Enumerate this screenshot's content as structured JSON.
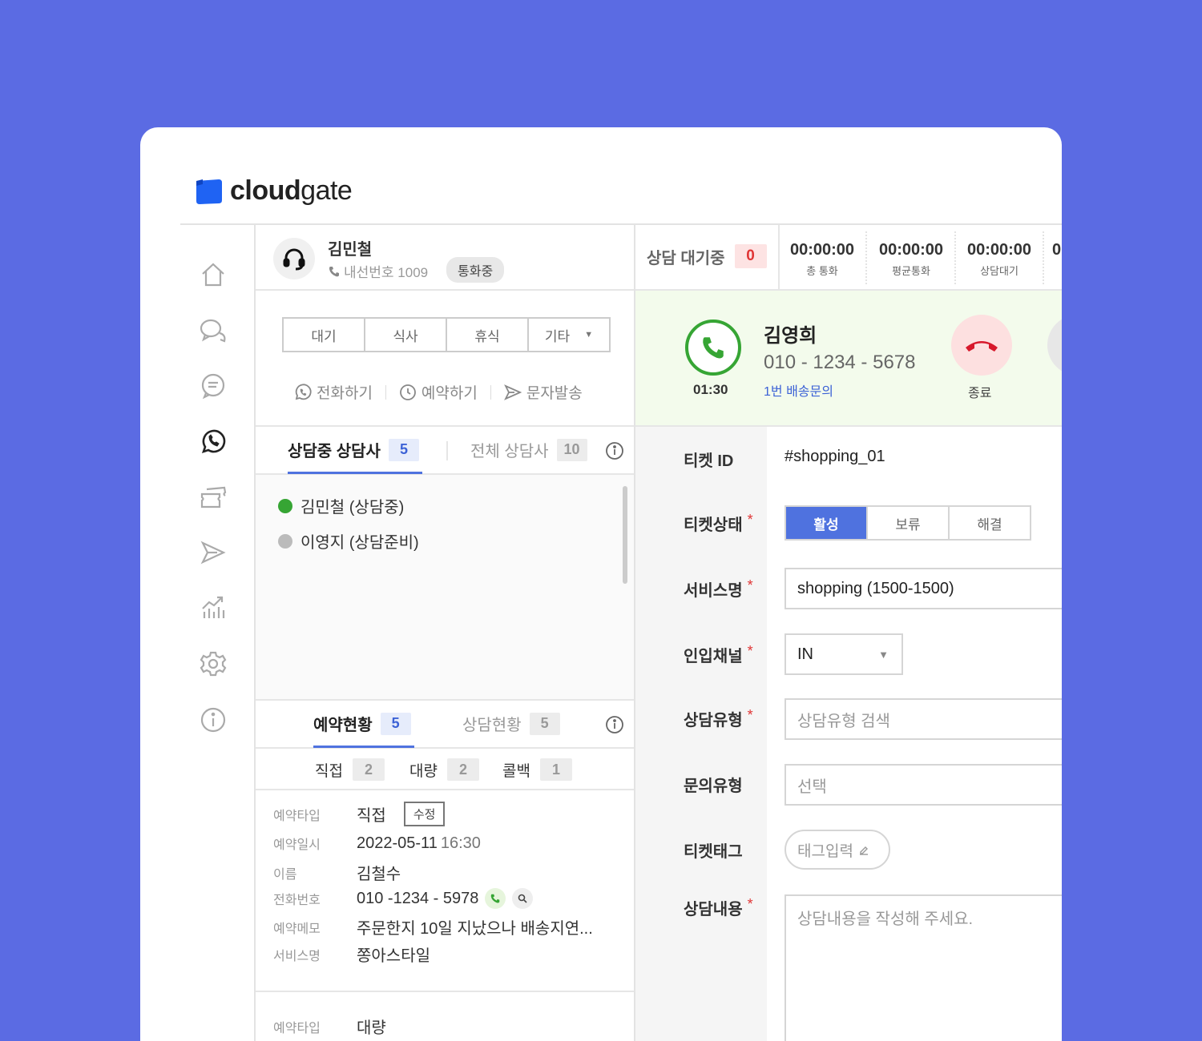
{
  "brand": {
    "name_bold": "cloud",
    "name_light": "gate",
    "accent": "#1f63f3",
    "background": "#5b6be3"
  },
  "agent": {
    "name": "김민철",
    "extension": "내선번호 1009",
    "status": "통화중"
  },
  "status_buttons": [
    "대기",
    "식사",
    "휴식",
    "기타"
  ],
  "actions": {
    "call": "전화하기",
    "reserve": "예약하기",
    "sms": "문자발송"
  },
  "agent_tabs": {
    "active": {
      "label": "상담중 상담사",
      "count": "5"
    },
    "all": {
      "label": "전체 상담사",
      "count": "10"
    }
  },
  "agent_list": [
    {
      "label": "김민철 (상담중)",
      "status_color": "#36a534"
    },
    {
      "label": "이영지 (상담준비)",
      "status_color": "#bbbbbb"
    }
  ],
  "reservation_tabs": {
    "reservations": {
      "label": "예약현황",
      "count": "5"
    },
    "consultations": {
      "label": "상담현황",
      "count": "5"
    }
  },
  "subtabs": [
    {
      "label": "직접",
      "count": "2"
    },
    {
      "label": "대량",
      "count": "2"
    },
    {
      "label": "콜백",
      "count": "1"
    }
  ],
  "reservation": {
    "type_label": "예약타입",
    "type_value": "직접",
    "edit_label": "수정",
    "datetime_label": "예약일시",
    "datetime_date": "2022-05-11",
    "datetime_time": "16:30",
    "name_label": "이름",
    "name_value": "김철수",
    "phone_label": "전화번호",
    "phone_value": "010 -1234 - 5978",
    "memo_label": "예약메모",
    "memo_value": "주문한지 10일 지났으나 배송지연...",
    "service_label": "서비스명",
    "service_value": "쫑아스타일",
    "next_type_label": "예약타입",
    "next_type_value": "대량"
  },
  "stats": {
    "waiting_label": "상담 대기중",
    "waiting_count": "0",
    "items": [
      {
        "time": "00:00:00",
        "label": "총 통화"
      },
      {
        "time": "00:00:00",
        "label": "평균통화"
      },
      {
        "time": "00:00:00",
        "label": "상담대기"
      },
      {
        "time": "0",
        "label": ""
      }
    ]
  },
  "call": {
    "timer": "01:30",
    "caller_name": "김영희",
    "caller_phone": "010 - 1234 - 5678",
    "caller_sub": "1번 배송문의",
    "end_label": "종료"
  },
  "ticket": {
    "id_label": "티켓 ID",
    "id_value": "#shopping_01",
    "status_label": "티켓상태",
    "status_options": [
      "활성",
      "보류",
      "해결"
    ],
    "service_label": "서비스명",
    "service_value": "shopping (1500-1500)",
    "channel_label": "인입채널",
    "channel_value": "IN",
    "type_label": "상담유형",
    "type_placeholder": "상담유형 검색",
    "inquiry_label": "문의유형",
    "inquiry_placeholder": "선택",
    "tag_label": "티켓태그",
    "tag_placeholder": "태그입력",
    "content_label": "상담내용",
    "content_placeholder": "상담내용을 작성해 주세요."
  }
}
